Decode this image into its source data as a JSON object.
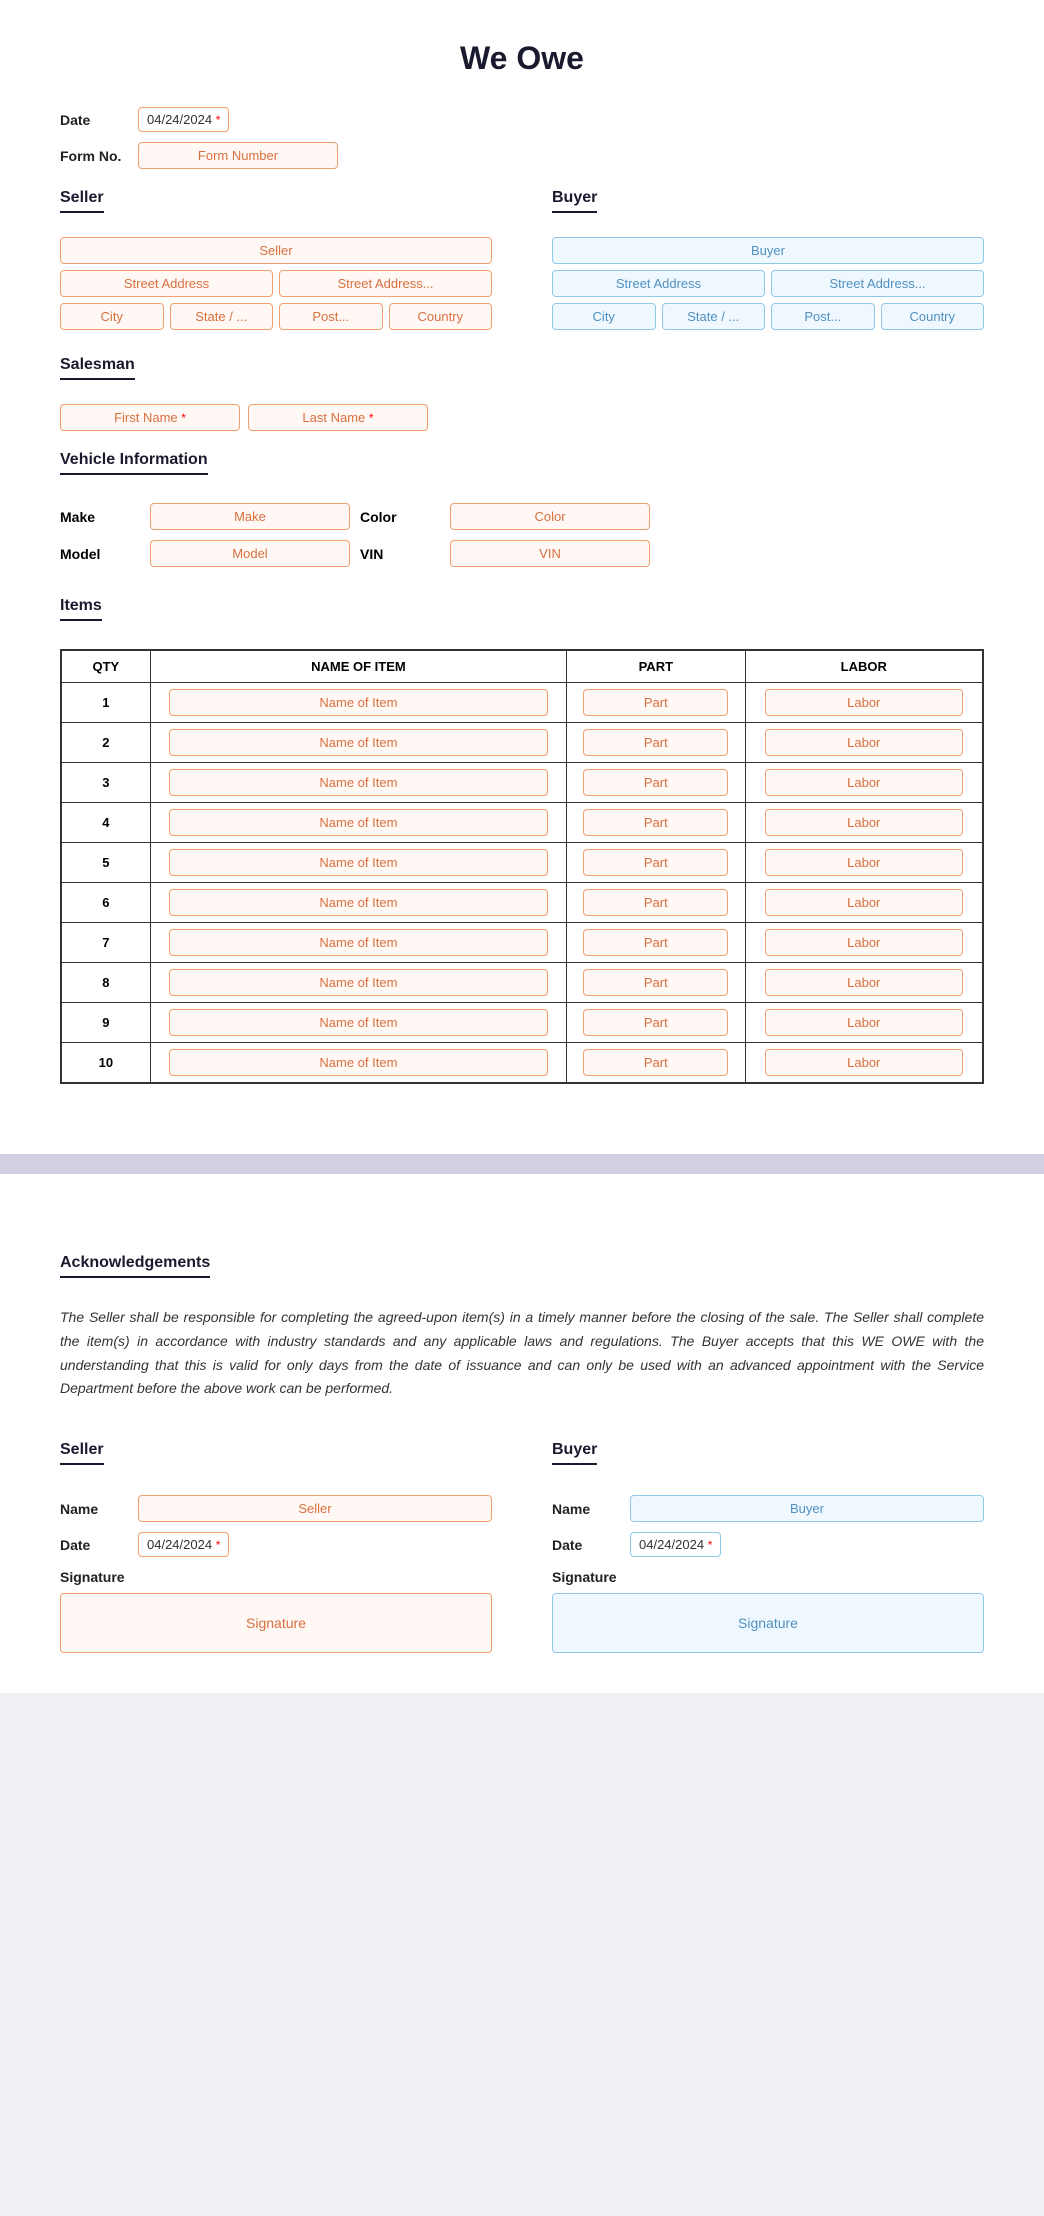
{
  "title": "We Owe",
  "date": {
    "label": "Date",
    "value": "04/24/2024",
    "required": true
  },
  "formNo": {
    "label": "Form No.",
    "placeholder": "Form Number"
  },
  "seller": {
    "sectionLabel": "Seller",
    "namePlaceholder": "Seller",
    "streetAddress1Placeholder": "Street Address",
    "streetAddress2Placeholder": "Street Address...",
    "cityPlaceholder": "City",
    "statePlaceholder": "State / ...",
    "postPlaceholder": "Post...",
    "countryPlaceholder": "Country"
  },
  "buyer": {
    "sectionLabel": "Buyer",
    "namePlaceholder": "Buyer",
    "streetAddress1Placeholder": "Street Address",
    "streetAddress2Placeholder": "Street Address...",
    "cityPlaceholder": "City",
    "statePlaceholder": "State / ...",
    "postPlaceholder": "Post...",
    "countryPlaceholder": "Country"
  },
  "salesman": {
    "sectionLabel": "Salesman",
    "firstNamePlaceholder": "First Name",
    "lastNamePlaceholder": "Last Name",
    "firstRequired": true,
    "lastRequired": true
  },
  "vehicleInfo": {
    "sectionLabel": "Vehicle Information",
    "makeLabel": "Make",
    "makePlaceholder": "Make",
    "colorLabel": "Color",
    "colorPlaceholder": "Color",
    "modelLabel": "Model",
    "modelPlaceholder": "Model",
    "vinLabel": "VIN",
    "vinPlaceholder": "VIN"
  },
  "items": {
    "sectionLabel": "Items",
    "columns": [
      "QTY",
      "NAME OF ITEM",
      "PART",
      "LABOR"
    ],
    "rows": [
      {
        "qty": "1",
        "name": "Name of Item",
        "part": "Part",
        "labor": "Labor"
      },
      {
        "qty": "2",
        "name": "Name of Item",
        "part": "Part",
        "labor": "Labor"
      },
      {
        "qty": "3",
        "name": "Name of Item",
        "part": "Part",
        "labor": "Labor"
      },
      {
        "qty": "4",
        "name": "Name of Item",
        "part": "Part",
        "labor": "Labor"
      },
      {
        "qty": "5",
        "name": "Name of Item",
        "part": "Part",
        "labor": "Labor"
      },
      {
        "qty": "6",
        "name": "Name of Item",
        "part": "Part",
        "labor": "Labor"
      },
      {
        "qty": "7",
        "name": "Name of Item",
        "part": "Part",
        "labor": "Labor"
      },
      {
        "qty": "8",
        "name": "Name of Item",
        "part": "Part",
        "labor": "Labor"
      },
      {
        "qty": "9",
        "name": "Name of Item",
        "part": "Part",
        "labor": "Labor"
      },
      {
        "qty": "10",
        "name": "Name of Item",
        "part": "Part",
        "labor": "Labor"
      }
    ]
  },
  "acknowledgements": {
    "sectionLabel": "Acknowledgements",
    "text": "The Seller shall be responsible for completing the agreed-upon item(s) in a timely manner before the closing of the sale. The Seller shall complete the item(s) in accordance with industry standards and any applicable laws and regulations. The Buyer accepts that this WE OWE with the understanding that this is valid for only days from the date of issuance and can only be used with an advanced appointment with the Service Department before the above work can be performed."
  },
  "signatures": {
    "seller": {
      "label": "Seller",
      "nameLabel": "Name",
      "namePlaceholder": "Seller",
      "dateLabel": "Date",
      "dateValue": "04/24/2024",
      "signatureLabel": "Signature",
      "signaturePlaceholder": "Signature"
    },
    "buyer": {
      "label": "Buyer",
      "nameLabel": "Name",
      "namePlaceholder": "Buyer",
      "dateLabel": "Date",
      "dateValue": "04/24/2024",
      "signatureLabel": "Signature",
      "signaturePlaceholder": "Signature"
    }
  }
}
